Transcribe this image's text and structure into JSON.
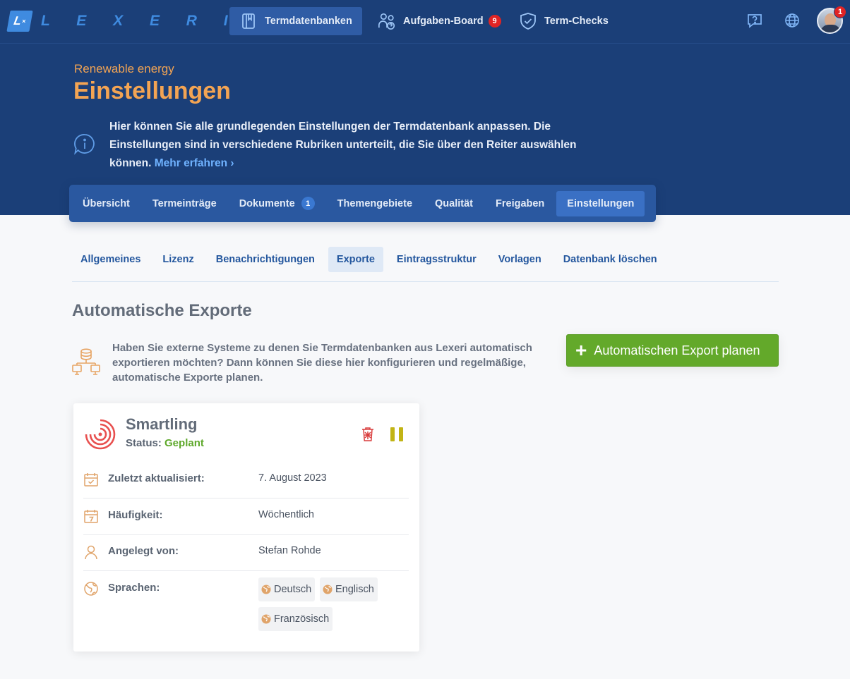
{
  "app": {
    "logo_mark": "L×",
    "logo_text": "LEXERI"
  },
  "topnav": {
    "items": [
      {
        "label": "Termdatenbanken",
        "icon": "book-icon",
        "active": true
      },
      {
        "label": "Aufgaben-Board",
        "icon": "users-question-icon",
        "badge": "9"
      },
      {
        "label": "Term-Checks",
        "icon": "shield-check-icon"
      }
    ],
    "help_icon": "help-icon",
    "language_icon": "globe-icon",
    "avatar_badge": "1"
  },
  "hero": {
    "breadcrumb": "Renewable energy",
    "title": "Einstellungen",
    "info_text": "Hier können Sie alle grundlegenden Einstellungen der Termdatenbank anpassen. Die Einstellungen sind in verschiedene Rubriken unterteilt, die Sie über den Reiter auswählen können.",
    "info_link": "Mehr erfahren ›"
  },
  "tabs": [
    {
      "label": "Übersicht"
    },
    {
      "label": "Termeinträge"
    },
    {
      "label": "Dokumente",
      "badge": "1"
    },
    {
      "label": "Themengebiete"
    },
    {
      "label": "Qualität"
    },
    {
      "label": "Freigaben"
    },
    {
      "label": "Einstellungen",
      "active": true
    }
  ],
  "subnav": [
    {
      "label": "Allgemeines"
    },
    {
      "label": "Lizenz"
    },
    {
      "label": "Benachrichtigungen"
    },
    {
      "label": "Exporte",
      "active": true
    },
    {
      "label": "Eintragsstruktur"
    },
    {
      "label": "Vorlagen"
    },
    {
      "label": "Datenbank löschen"
    }
  ],
  "section": {
    "title": "Automatische Exporte",
    "description": "Haben Sie externe Systeme zu denen Sie Termdatenbanken aus Lexeri automatisch exportieren möchten? Dann können Sie diese hier konfigurieren und regelmäßige, automatische Exporte planen.",
    "button_label": "Automatischen Export planen",
    "button_icon": "+"
  },
  "export_card": {
    "name": "Smartling",
    "status_label": "Status:",
    "status_value": "Geplant",
    "rows": [
      {
        "label": "Zuletzt aktualisiert:",
        "value": "7. August 2023",
        "icon": "calendar-check-icon"
      },
      {
        "label": "Häufigkeit:",
        "value": "Wöchentlich",
        "icon": "calendar-7-icon"
      },
      {
        "label": "Angelegt von:",
        "value": "Stefan Rohde",
        "icon": "user-icon"
      },
      {
        "label": "Sprachen:",
        "icon": "globe-icon"
      }
    ],
    "languages": [
      "Deutsch",
      "Englisch",
      "Französisch"
    ]
  },
  "colors": {
    "navy": "#1b3f78",
    "accent_orange": "#f3a453",
    "primary_green": "#63a92a",
    "status_green": "#5ea82b",
    "link_blue": "#24579e"
  }
}
